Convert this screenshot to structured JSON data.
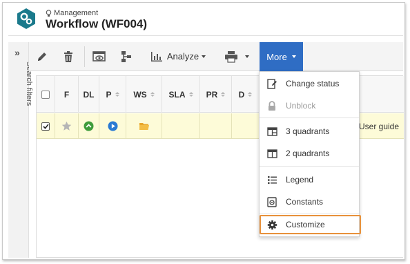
{
  "header": {
    "breadcrumb": "Management",
    "title": "Workflow (WF004)"
  },
  "side_panel": {
    "label": "Search filters"
  },
  "toolbar": {
    "analyze_label": "Analyze",
    "more_label": "More"
  },
  "grid": {
    "columns": [
      "F",
      "DL",
      "P",
      "WS",
      "SLA",
      "PR",
      "D"
    ],
    "row": {
      "selected": true,
      "starred": false,
      "trailing_text": "User guide"
    }
  },
  "menu": {
    "items": [
      {
        "label": "Change status",
        "icon": "edit-doc-icon",
        "enabled": true
      },
      {
        "label": "Unblock",
        "icon": "lock-icon",
        "enabled": false
      },
      {
        "label": "3 quadrants",
        "icon": "layout-3-icon",
        "enabled": true
      },
      {
        "label": "2 quadrants",
        "icon": "layout-2-icon",
        "enabled": true
      },
      {
        "label": "Legend",
        "icon": "list-icon",
        "enabled": true
      },
      {
        "label": "Constants",
        "icon": "constants-icon",
        "enabled": true
      },
      {
        "label": "Customize",
        "icon": "gear-icon",
        "enabled": true,
        "highlighted": true
      }
    ]
  },
  "colors": {
    "accent": "#2f6dc4",
    "highlight": "#e8913b",
    "row_bg": "#fdfbd8",
    "brand": "#1b7a8c"
  }
}
